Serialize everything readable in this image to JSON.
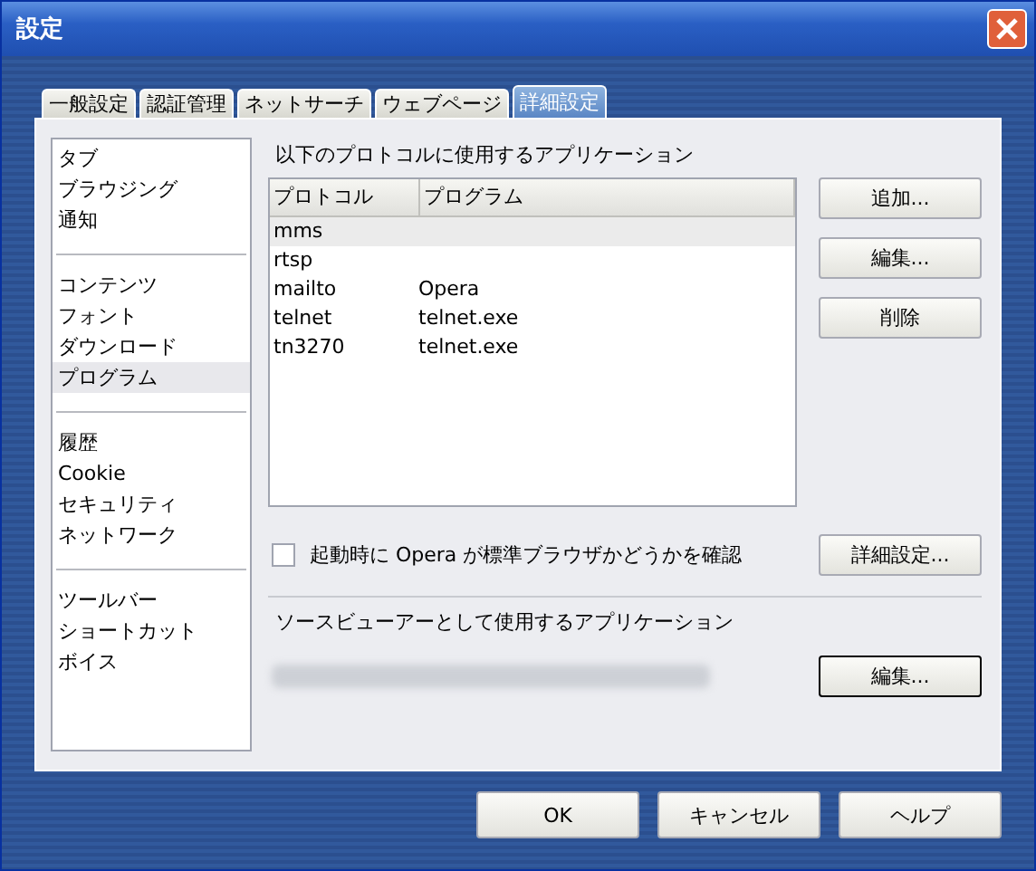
{
  "window": {
    "title": "設定"
  },
  "tabs": [
    {
      "label": "一般設定",
      "selected": false
    },
    {
      "label": "認証管理",
      "selected": false
    },
    {
      "label": "ネットサーチ",
      "selected": false
    },
    {
      "label": "ウェブページ",
      "selected": false
    },
    {
      "label": "詳細設定",
      "selected": true
    }
  ],
  "sidebar": {
    "groups": [
      [
        {
          "label": "タブ",
          "selected": false
        },
        {
          "label": "ブラウジング",
          "selected": false
        },
        {
          "label": "通知",
          "selected": false
        }
      ],
      [
        {
          "label": "コンテンツ",
          "selected": false
        },
        {
          "label": "フォント",
          "selected": false
        },
        {
          "label": "ダウンロード",
          "selected": false
        },
        {
          "label": "プログラム",
          "selected": true
        }
      ],
      [
        {
          "label": "履歴",
          "selected": false
        },
        {
          "label": "Cookie",
          "selected": false
        },
        {
          "label": "セキュリティ",
          "selected": false
        },
        {
          "label": "ネットワーク",
          "selected": false
        }
      ],
      [
        {
          "label": "ツールバー",
          "selected": false
        },
        {
          "label": "ショートカット",
          "selected": false
        },
        {
          "label": "ボイス",
          "selected": false
        }
      ]
    ]
  },
  "protocols": {
    "heading": "以下のプロトコルに使用するアプリケーション",
    "columns": [
      "プロトコル",
      "プログラム"
    ],
    "rows": [
      {
        "cells": [
          "mms",
          ""
        ],
        "selected": true
      },
      {
        "cells": [
          "rtsp",
          ""
        ],
        "selected": false
      },
      {
        "cells": [
          "mailto",
          "Opera"
        ],
        "selected": false
      },
      {
        "cells": [
          "telnet",
          "telnet.exe"
        ],
        "selected": false
      },
      {
        "cells": [
          "tn3270",
          "telnet.exe"
        ],
        "selected": false
      }
    ],
    "buttons": [
      "追加...",
      "編集...",
      "削除"
    ]
  },
  "default_check": {
    "label": "起動時に Opera が標準ブラウザかどうかを確認",
    "checked": false,
    "button": "詳細設定..."
  },
  "source_viewer": {
    "heading": "ソースビューアーとして使用するアプリケーション",
    "button": "編集..."
  },
  "buttons": [
    "OK",
    "キャンセル",
    "ヘルプ"
  ]
}
